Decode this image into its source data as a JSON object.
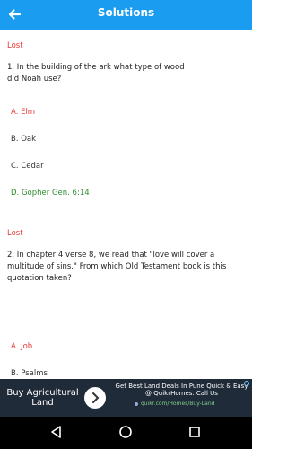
{
  "appbar": {
    "title": "Solutions"
  },
  "questions": [
    {
      "status": "Lost",
      "text": "1. In the building of the ark what type of wood did Noah use?",
      "options": [
        "A. Elm",
        "B. Oak",
        "C. Cedar",
        "D. Gopher Gen. 6:14"
      ]
    },
    {
      "status": "Lost",
      "text": "2. In chapter 4 verse 8, we read that \"love will cover a multitude of sins.\" From which Old Testament book is this quotation taken?",
      "options": [
        "A. Job",
        "B. Psalms"
      ]
    }
  ],
  "ad": {
    "left_text": "Buy Agricultural Land",
    "headline": "Get Best Land Deals In Pune Quick & Easy @ QuikrHomes. Call Us",
    "url": "quikr.com/Homes/Buy-Land"
  },
  "colors": {
    "appbar": "#1a9cf0",
    "wrong": "#e53935",
    "correct": "#2e8b2e"
  },
  "icons": {
    "back": "back-arrow-icon",
    "nav_back": "nav-back-icon",
    "nav_home": "nav-home-icon",
    "nav_recents": "nav-recents-icon",
    "ad_next": "chevron-right-icon"
  }
}
